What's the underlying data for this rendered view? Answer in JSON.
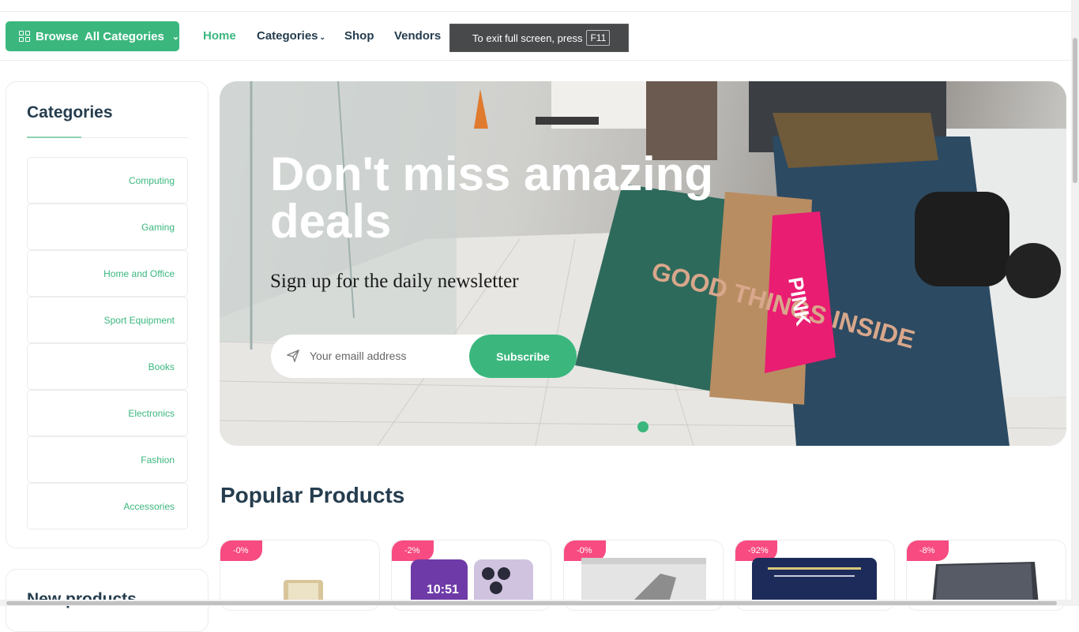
{
  "nav": {
    "browse_label": "Browse  All Categories",
    "menu": [
      "Home",
      "Categories",
      "Shop",
      "Vendors"
    ],
    "fullscreen_tip": "To exit full screen, press",
    "fullscreen_key": "F11"
  },
  "sidebar": {
    "title": "Categories",
    "items": [
      "Computing",
      "Gaming",
      "Home and Office",
      "Sport Equipment",
      "Books",
      "Electronics",
      "Fashion",
      "Accessories"
    ],
    "second_title": "New products"
  },
  "hero": {
    "headline": "Don't miss amazing deals",
    "subtitle": "Sign up for the daily newsletter",
    "email_placeholder": "Your emaill address",
    "subscribe_label": "Subscribe",
    "bag_text_1": "GOOD THINGS INSIDE",
    "bag_text_2": "PINK"
  },
  "popular": {
    "title": "Popular Products",
    "badges": [
      "-0%",
      "-2%",
      "-0%",
      "-92%",
      "-8%"
    ],
    "phone_time": "10:51"
  },
  "colors": {
    "accent": "#3bb77e",
    "badge": "#f74b81",
    "heading": "#253d4e"
  }
}
